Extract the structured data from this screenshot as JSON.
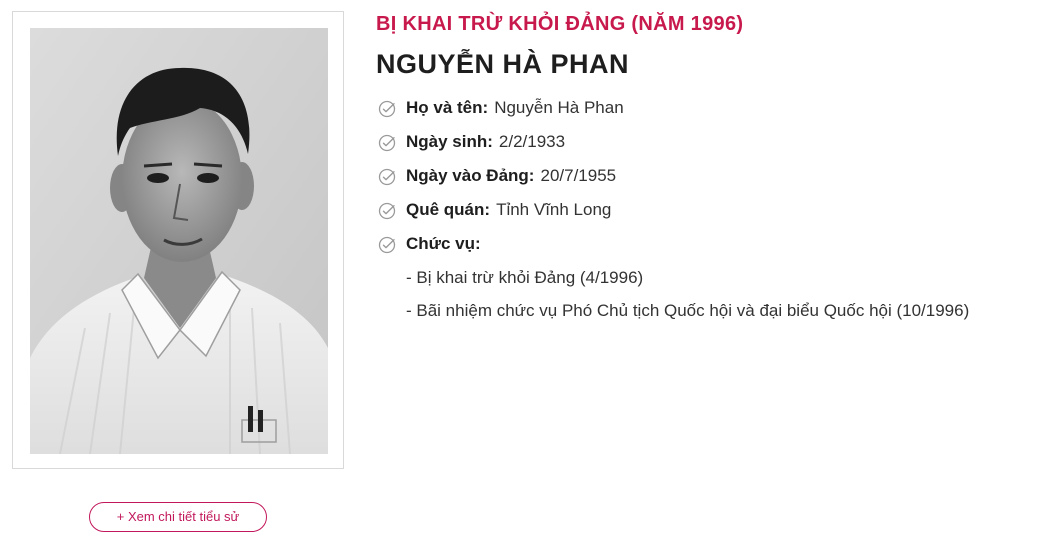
{
  "photo": {
    "alt": "Nguyễn Hà Phan",
    "icon": "portrait-photo"
  },
  "detail_button": {
    "label": "+ Xem chi tiết tiểu sử"
  },
  "category": "BỊ KHAI TRỪ KHỎI ĐẢNG (NĂM 1996)",
  "name": "NGUYỄN HÀ PHAN",
  "fields": [
    {
      "label": "Họ và tên:",
      "value": "Nguyễn Hà Phan",
      "icon": "check-circle-icon"
    },
    {
      "label": "Ngày sinh:",
      "value": "2/2/1933",
      "icon": "check-circle-icon"
    },
    {
      "label": "Ngày vào Đảng:",
      "value": "20/7/1955",
      "icon": "check-circle-icon"
    },
    {
      "label": "Quê quán:",
      "value": "Tỉnh Vĩnh Long",
      "icon": "check-circle-icon"
    },
    {
      "label": "Chức vụ:",
      "value": "",
      "icon": "check-circle-icon"
    }
  ],
  "roles": [
    "- Bị khai trừ khỏi Đảng (4/1996)",
    "- Bãi nhiệm chức vụ Phó Chủ tịch Quốc hội và đại biểu Quốc hội (10/1996)"
  ],
  "colors": {
    "accent": "#c8194d",
    "text": "#1e1e1e",
    "icon": "#9a9a9a"
  }
}
